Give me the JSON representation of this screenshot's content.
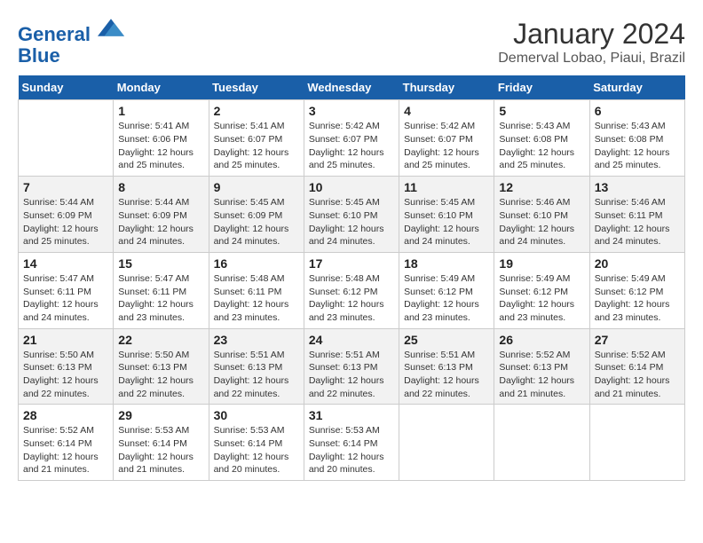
{
  "header": {
    "logo_line1": "General",
    "logo_line2": "Blue",
    "month": "January 2024",
    "location": "Demerval Lobao, Piaui, Brazil"
  },
  "days_of_week": [
    "Sunday",
    "Monday",
    "Tuesday",
    "Wednesday",
    "Thursday",
    "Friday",
    "Saturday"
  ],
  "weeks": [
    [
      {
        "num": "",
        "info": ""
      },
      {
        "num": "1",
        "info": "Sunrise: 5:41 AM\nSunset: 6:06 PM\nDaylight: 12 hours\nand 25 minutes."
      },
      {
        "num": "2",
        "info": "Sunrise: 5:41 AM\nSunset: 6:07 PM\nDaylight: 12 hours\nand 25 minutes."
      },
      {
        "num": "3",
        "info": "Sunrise: 5:42 AM\nSunset: 6:07 PM\nDaylight: 12 hours\nand 25 minutes."
      },
      {
        "num": "4",
        "info": "Sunrise: 5:42 AM\nSunset: 6:07 PM\nDaylight: 12 hours\nand 25 minutes."
      },
      {
        "num": "5",
        "info": "Sunrise: 5:43 AM\nSunset: 6:08 PM\nDaylight: 12 hours\nand 25 minutes."
      },
      {
        "num": "6",
        "info": "Sunrise: 5:43 AM\nSunset: 6:08 PM\nDaylight: 12 hours\nand 25 minutes."
      }
    ],
    [
      {
        "num": "7",
        "info": "Sunrise: 5:44 AM\nSunset: 6:09 PM\nDaylight: 12 hours\nand 25 minutes."
      },
      {
        "num": "8",
        "info": "Sunrise: 5:44 AM\nSunset: 6:09 PM\nDaylight: 12 hours\nand 24 minutes."
      },
      {
        "num": "9",
        "info": "Sunrise: 5:45 AM\nSunset: 6:09 PM\nDaylight: 12 hours\nand 24 minutes."
      },
      {
        "num": "10",
        "info": "Sunrise: 5:45 AM\nSunset: 6:10 PM\nDaylight: 12 hours\nand 24 minutes."
      },
      {
        "num": "11",
        "info": "Sunrise: 5:45 AM\nSunset: 6:10 PM\nDaylight: 12 hours\nand 24 minutes."
      },
      {
        "num": "12",
        "info": "Sunrise: 5:46 AM\nSunset: 6:10 PM\nDaylight: 12 hours\nand 24 minutes."
      },
      {
        "num": "13",
        "info": "Sunrise: 5:46 AM\nSunset: 6:11 PM\nDaylight: 12 hours\nand 24 minutes."
      }
    ],
    [
      {
        "num": "14",
        "info": "Sunrise: 5:47 AM\nSunset: 6:11 PM\nDaylight: 12 hours\nand 24 minutes."
      },
      {
        "num": "15",
        "info": "Sunrise: 5:47 AM\nSunset: 6:11 PM\nDaylight: 12 hours\nand 23 minutes."
      },
      {
        "num": "16",
        "info": "Sunrise: 5:48 AM\nSunset: 6:11 PM\nDaylight: 12 hours\nand 23 minutes."
      },
      {
        "num": "17",
        "info": "Sunrise: 5:48 AM\nSunset: 6:12 PM\nDaylight: 12 hours\nand 23 minutes."
      },
      {
        "num": "18",
        "info": "Sunrise: 5:49 AM\nSunset: 6:12 PM\nDaylight: 12 hours\nand 23 minutes."
      },
      {
        "num": "19",
        "info": "Sunrise: 5:49 AM\nSunset: 6:12 PM\nDaylight: 12 hours\nand 23 minutes."
      },
      {
        "num": "20",
        "info": "Sunrise: 5:49 AM\nSunset: 6:12 PM\nDaylight: 12 hours\nand 23 minutes."
      }
    ],
    [
      {
        "num": "21",
        "info": "Sunrise: 5:50 AM\nSunset: 6:13 PM\nDaylight: 12 hours\nand 22 minutes."
      },
      {
        "num": "22",
        "info": "Sunrise: 5:50 AM\nSunset: 6:13 PM\nDaylight: 12 hours\nand 22 minutes."
      },
      {
        "num": "23",
        "info": "Sunrise: 5:51 AM\nSunset: 6:13 PM\nDaylight: 12 hours\nand 22 minutes."
      },
      {
        "num": "24",
        "info": "Sunrise: 5:51 AM\nSunset: 6:13 PM\nDaylight: 12 hours\nand 22 minutes."
      },
      {
        "num": "25",
        "info": "Sunrise: 5:51 AM\nSunset: 6:13 PM\nDaylight: 12 hours\nand 22 minutes."
      },
      {
        "num": "26",
        "info": "Sunrise: 5:52 AM\nSunset: 6:13 PM\nDaylight: 12 hours\nand 21 minutes."
      },
      {
        "num": "27",
        "info": "Sunrise: 5:52 AM\nSunset: 6:14 PM\nDaylight: 12 hours\nand 21 minutes."
      }
    ],
    [
      {
        "num": "28",
        "info": "Sunrise: 5:52 AM\nSunset: 6:14 PM\nDaylight: 12 hours\nand 21 minutes."
      },
      {
        "num": "29",
        "info": "Sunrise: 5:53 AM\nSunset: 6:14 PM\nDaylight: 12 hours\nand 21 minutes."
      },
      {
        "num": "30",
        "info": "Sunrise: 5:53 AM\nSunset: 6:14 PM\nDaylight: 12 hours\nand 20 minutes."
      },
      {
        "num": "31",
        "info": "Sunrise: 5:53 AM\nSunset: 6:14 PM\nDaylight: 12 hours\nand 20 minutes."
      },
      {
        "num": "",
        "info": ""
      },
      {
        "num": "",
        "info": ""
      },
      {
        "num": "",
        "info": ""
      }
    ]
  ]
}
